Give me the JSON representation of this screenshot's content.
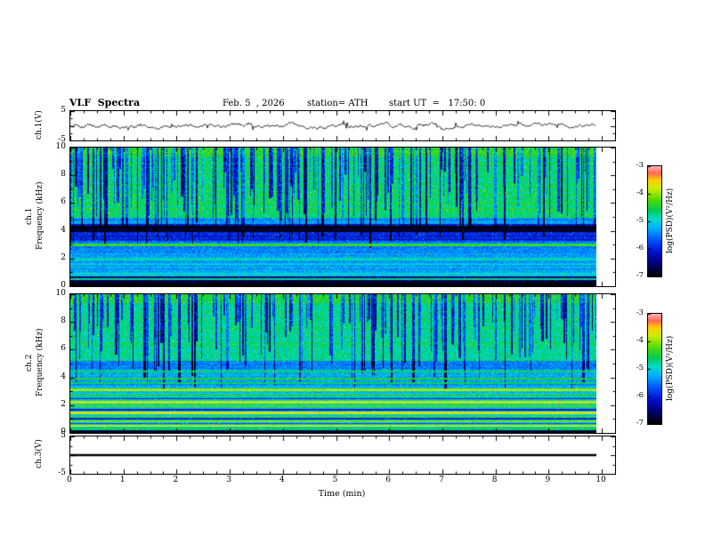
{
  "header": {
    "title": "VLF  Spectra",
    "date": "Feb. 5  , 2026",
    "station": "station= ATH",
    "start_ut": "start UT  =   17:50: 0"
  },
  "chart_data": {
    "type": "heatmap",
    "title": "VLF Spectra",
    "x_label": "Time  (min)",
    "x_ticks": [
      0,
      1,
      2,
      3,
      4,
      5,
      6,
      7,
      8,
      9,
      10
    ],
    "x_range": [
      0,
      10.25
    ],
    "x_data_extent": 9.9,
    "colormap": [
      [
        0.0,
        "#000000"
      ],
      [
        0.1,
        "#000066"
      ],
      [
        0.22,
        "#0010cc"
      ],
      [
        0.33,
        "#0055ff"
      ],
      [
        0.43,
        "#00aaff"
      ],
      [
        0.52,
        "#00ddcc"
      ],
      [
        0.6,
        "#00cc55"
      ],
      [
        0.7,
        "#55dd00"
      ],
      [
        0.8,
        "#ccee00"
      ],
      [
        0.88,
        "#ffcc00"
      ],
      [
        0.94,
        "#ff6655"
      ],
      [
        1.0,
        "#ffb0b0"
      ]
    ],
    "colorbar": {
      "label": "log(PSD)(V²/Hz)",
      "ticks": [
        -3,
        -4,
        -5,
        -6,
        -7
      ],
      "vmin": -7,
      "vmax": -3
    },
    "panels": {
      "ch1wave": {
        "kind": "line",
        "ylabel": "ch.1(V)",
        "y_ticks": [
          5,
          -5
        ],
        "tick_majors": [
          -5,
          0,
          5
        ],
        "tick_minors": [
          -2.5,
          2.5
        ],
        "y_range": [
          -5,
          5
        ],
        "seed": 5,
        "amp": 0.95
      },
      "ch1spec": {
        "kind": "spectrogram",
        "ylabel_line1": "ch.1",
        "ylabel_line2": "Frequency (kHz)",
        "y_ticks": [
          0,
          2,
          4,
          6,
          8,
          10
        ],
        "tick_minors": [
          1,
          3,
          5,
          7,
          9
        ],
        "y_range": [
          0,
          10
        ],
        "seed": 11,
        "noise": 0.6,
        "bg": [
          [
            5.0,
            10.01,
            -4.65
          ],
          [
            4.55,
            5.0,
            -5.4
          ],
          [
            3.3,
            4.55,
            -6.0
          ],
          [
            2.4,
            3.3,
            -5.5
          ],
          [
            1.05,
            2.4,
            -5.35
          ],
          [
            0.75,
            1.05,
            -5.1
          ],
          [
            0.0,
            0.75,
            -6.6
          ]
        ],
        "lines": [
          [
            4.15,
            0.22,
            -6.85
          ],
          [
            3.0,
            0.1,
            -4.35
          ],
          [
            2.0,
            0.08,
            -4.9
          ],
          [
            1.62,
            0.06,
            -5.05
          ],
          [
            0.9,
            0.05,
            -4.95
          ],
          [
            0.52,
            0.07,
            -4.7
          ],
          [
            0.3,
            0.05,
            -6.9
          ],
          [
            0.12,
            0.12,
            -6.95
          ]
        ],
        "streaks": {
          "count": 210,
          "depth_min": 0.9,
          "depth_max": 2.4,
          "fmin_lo": 2.8,
          "fmin_hi": 8.5
        }
      },
      "ch2spec": {
        "kind": "spectrogram",
        "ylabel_line1": "ch.2",
        "ylabel_line2": "Frequency (kHz)",
        "y_ticks": [
          0,
          2,
          4,
          6,
          8,
          10
        ],
        "tick_minors": [
          1,
          3,
          5,
          7,
          9
        ],
        "y_range": [
          0,
          10
        ],
        "seed": 23,
        "noise": 0.6,
        "bg": [
          [
            5.2,
            10.01,
            -4.75
          ],
          [
            4.6,
            5.2,
            -5.5
          ],
          [
            3.4,
            4.6,
            -5.3
          ],
          [
            2.5,
            3.4,
            -5.15
          ],
          [
            0.25,
            2.5,
            -5.0
          ],
          [
            0.0,
            0.25,
            -6.8
          ]
        ],
        "lines": [
          [
            4.45,
            0.08,
            -4.5
          ],
          [
            3.95,
            0.07,
            -4.3
          ],
          [
            3.6,
            0.06,
            -4.6
          ],
          [
            3.15,
            0.09,
            -3.95
          ],
          [
            2.7,
            0.06,
            -4.4
          ],
          [
            2.5,
            0.04,
            -6.1
          ],
          [
            2.25,
            0.1,
            -3.8
          ],
          [
            1.95,
            0.07,
            -4.2
          ],
          [
            1.7,
            0.05,
            -6.2
          ],
          [
            1.5,
            0.09,
            -3.85
          ],
          [
            1.15,
            0.06,
            -4.3
          ],
          [
            1.05,
            0.04,
            -6.0
          ],
          [
            0.85,
            0.07,
            -4.1
          ],
          [
            0.72,
            0.04,
            -5.9
          ],
          [
            0.55,
            0.08,
            -3.75
          ],
          [
            0.35,
            0.05,
            -4.6
          ],
          [
            0.1,
            0.1,
            -6.9
          ]
        ],
        "streaks": {
          "count": 180,
          "depth_min": 0.9,
          "depth_max": 2.2,
          "fmin_lo": 3.2,
          "fmin_hi": 8.5
        }
      },
      "ch3wave": {
        "kind": "flat",
        "ylabel": "ch.3(V)",
        "y_ticks": [
          5,
          -5
        ],
        "tick_majors": [
          -5,
          0,
          5
        ],
        "tick_minors": [
          -2.5,
          2.5
        ],
        "y_range": [
          -5,
          5
        ],
        "flat_value": 0
      }
    }
  }
}
